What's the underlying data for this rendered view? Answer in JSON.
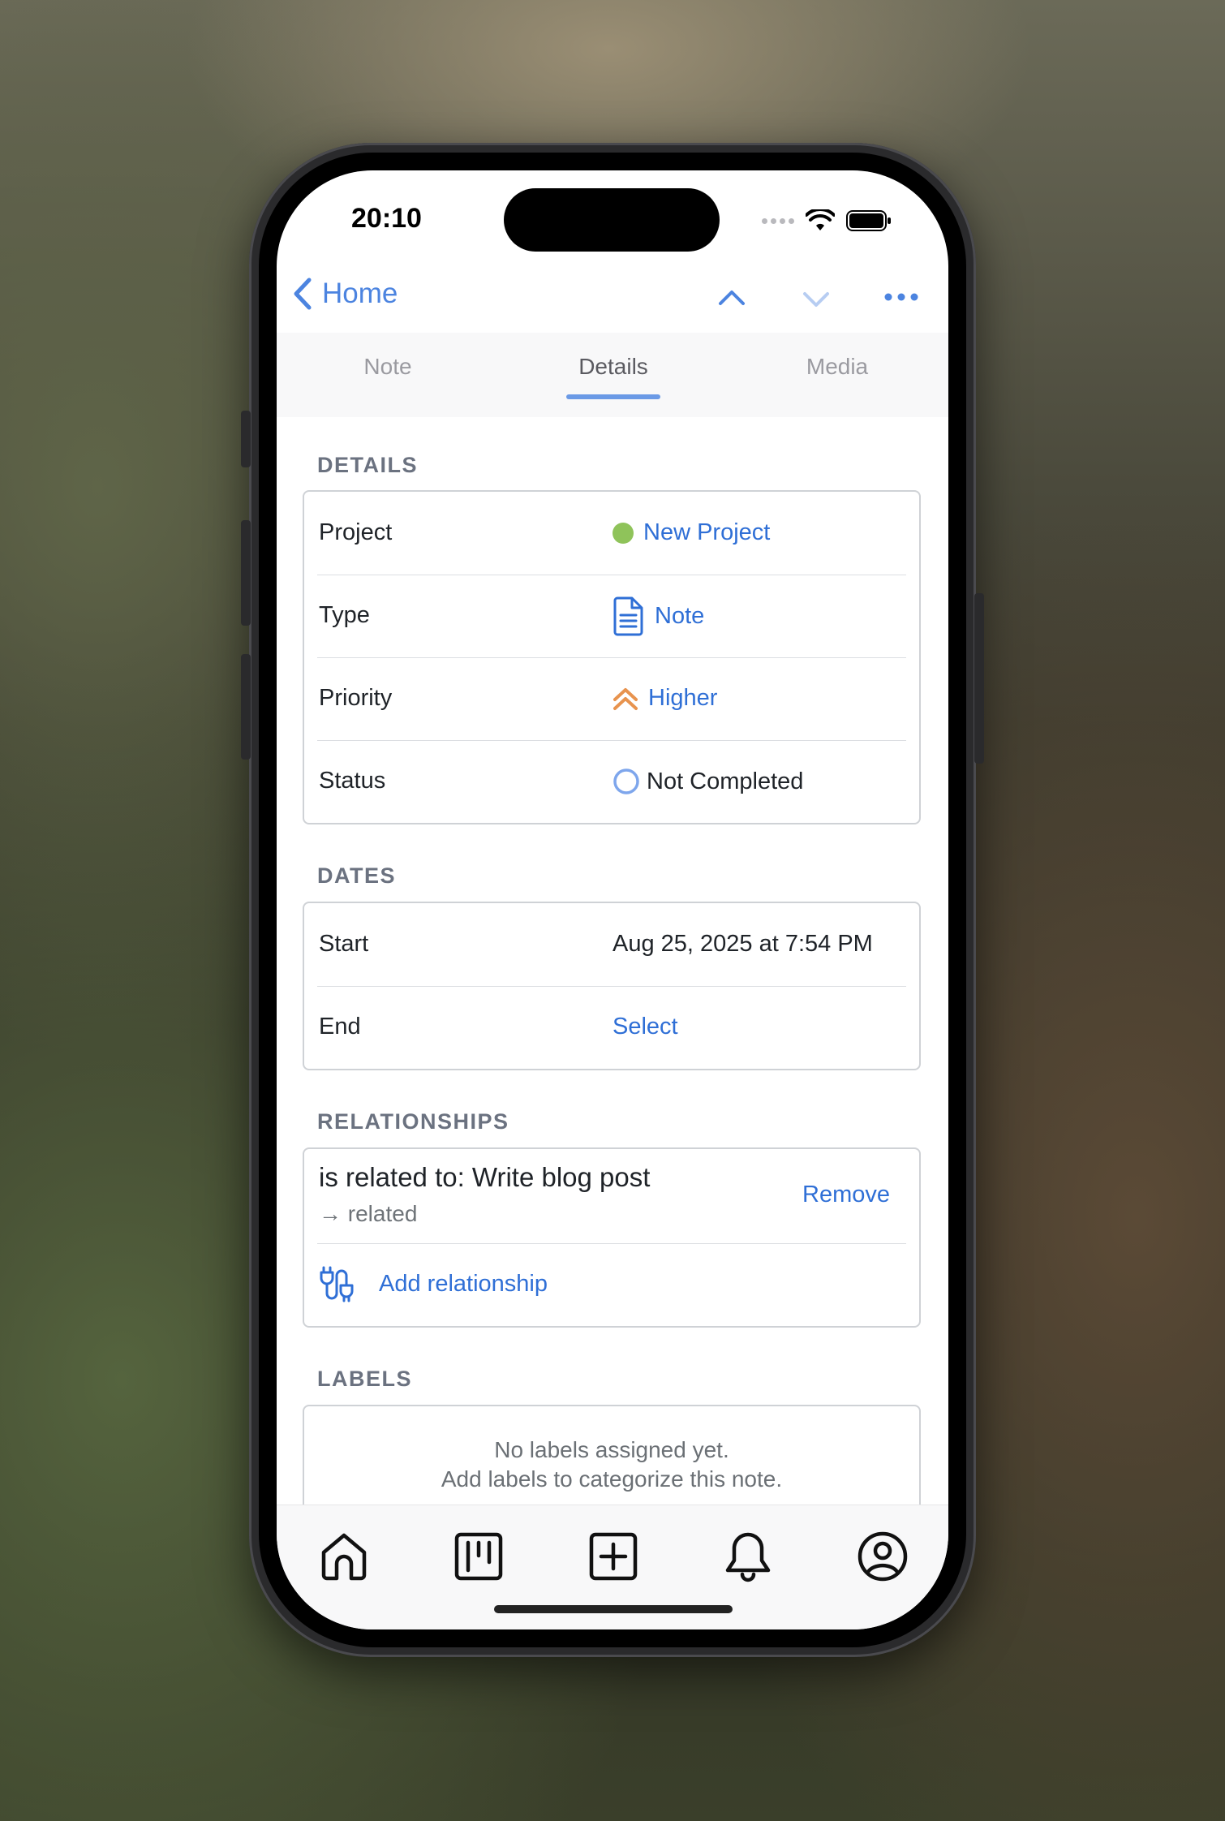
{
  "status_bar": {
    "time": "20:10"
  },
  "nav": {
    "back_label": "Home"
  },
  "tabs": [
    {
      "label": "Note",
      "active": false
    },
    {
      "label": "Details",
      "active": true
    },
    {
      "label": "Media",
      "active": false
    }
  ],
  "details": {
    "section_title": "DETAILS",
    "rows": [
      {
        "label": "Project",
        "value": "New Project",
        "icon": "green-dot-icon",
        "color": "#8fc35a"
      },
      {
        "label": "Type",
        "value": "Note",
        "icon": "document-icon"
      },
      {
        "label": "Priority",
        "value": "Higher",
        "icon": "double-chevron-up-icon",
        "color": "#e8934e"
      },
      {
        "label": "Status",
        "value": "Not Completed",
        "icon": "empty-circle-icon"
      }
    ]
  },
  "dates": {
    "section_title": "DATES",
    "rows": [
      {
        "label": "Start",
        "value": "Aug 25, 2025 at 7:54 PM"
      },
      {
        "label": "End",
        "value": "Select"
      }
    ]
  },
  "relationships": {
    "section_title": "RELATIONSHIPS",
    "items": [
      {
        "title": "is related to: Write blog post",
        "subtitle": "→ related",
        "action": "Remove"
      }
    ],
    "add_label": "Add relationship"
  },
  "labels": {
    "section_title": "LABELS",
    "empty_line1": "No labels assigned yet.",
    "empty_line2": "Add labels to categorize this note."
  },
  "tab_bar": [
    {
      "icon": "home-icon"
    },
    {
      "icon": "board-icon"
    },
    {
      "icon": "add-square-icon"
    },
    {
      "icon": "bell-icon"
    },
    {
      "icon": "profile-icon"
    }
  ],
  "colors": {
    "accent": "#2f6fd6",
    "nav_accent": "#4c84e0",
    "project_dot": "#8fc35a",
    "priority": "#e8934e"
  }
}
